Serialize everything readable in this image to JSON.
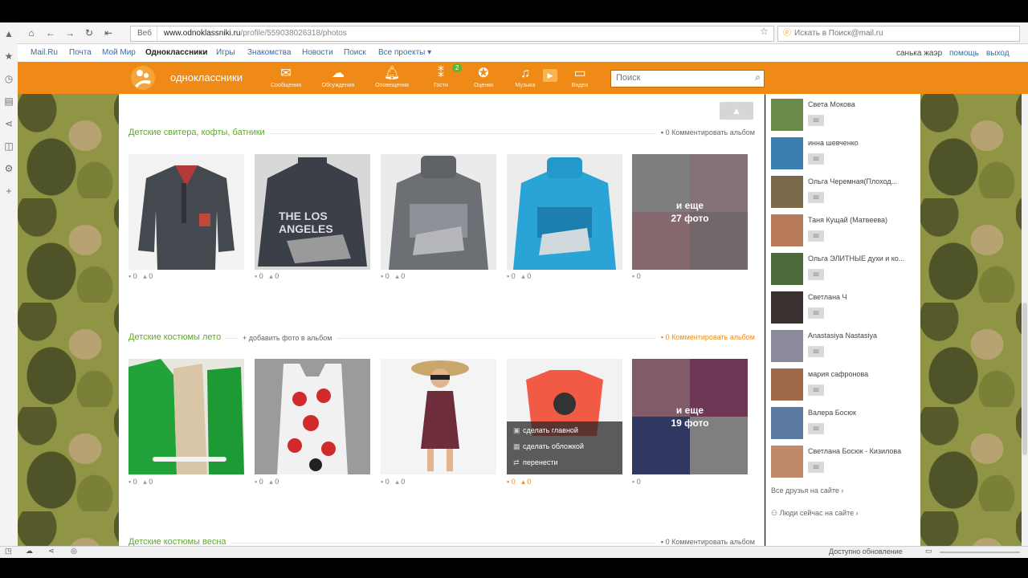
{
  "browser": {
    "url_scheme": "Веб",
    "url_domain": "www.odnoklassniki.ru",
    "url_path": "/profile/559038026318/photos",
    "search_placeholder": "Искать в Поиск@mail.ru"
  },
  "servicebar": {
    "links": [
      "Mail.Ru",
      "Почта",
      "Мой Мир",
      "Одноклассники",
      "Игры",
      "Знакомства",
      "Новости",
      "Поиск",
      "Все проекты ▾"
    ],
    "user": "санька жаэр",
    "help": "помощь",
    "logout": "выход"
  },
  "portal": {
    "logo_text": "одноклассники",
    "nav": [
      {
        "label": "Сообщения",
        "icon": "envelope-icon"
      },
      {
        "label": "Обсуждения",
        "icon": "chat-bubbles-icon"
      },
      {
        "label": "Оповещения",
        "icon": "bell-icon"
      },
      {
        "label": "Гости",
        "icon": "footprints-icon"
      },
      {
        "label": "Оценки",
        "icon": "ratings-icon"
      },
      {
        "label": "Музыка",
        "icon": "music-note-icon"
      },
      {
        "label": "Видео",
        "icon": "video-icon"
      }
    ],
    "guests_badge": "2",
    "search_placeholder": "Поиск"
  },
  "albums": [
    {
      "title": "Детские свитера, кофты, батники",
      "comment_label": "0 Комментировать альбом",
      "photos": [
        {
          "comments": "0",
          "likes": "0"
        },
        {
          "comments": "0",
          "likes": "0"
        },
        {
          "comments": "0",
          "likes": "0"
        },
        {
          "comments": "0",
          "likes": "0"
        },
        {
          "comments": "0",
          "more_line1": "и еще",
          "more_line2": "27 фото"
        }
      ]
    },
    {
      "title": "Детские костюмы лето",
      "add_photo": "добавить фото в альбом",
      "comment_label": "0 Комментировать альбом",
      "photos": [
        {
          "comments": "0",
          "likes": "0"
        },
        {
          "comments": "0",
          "likes": "0"
        },
        {
          "comments": "0",
          "likes": "0"
        },
        {
          "comments": "0",
          "likes": "0",
          "menu": [
            "сделать главной",
            "сделать обложкой",
            "перенести"
          ]
        },
        {
          "comments": "0",
          "more_line1": "и еще",
          "more_line2": "19 фото"
        }
      ]
    },
    {
      "title": "Детские костюмы весна",
      "comment_label": "0 Комментировать альбом"
    }
  ],
  "sidebar": {
    "friends": [
      "Света Мокова",
      "инна шевченко",
      "Ольга Черемная(Плоход...",
      "Таня Кущай (Матвеева)",
      "Ольга ЭЛИТНЫЕ духи и ко...",
      "Светлана Ч",
      "Anastasiya Nastasiya",
      "мария сафронова",
      "Валера Босюк",
      "Светлана Босюк - Кизилова"
    ],
    "all_friends": "Все друзья на сайте ›",
    "people_now": "Люди сейчас на сайте ›"
  },
  "statusbar": {
    "update": "Доступно обновление"
  }
}
